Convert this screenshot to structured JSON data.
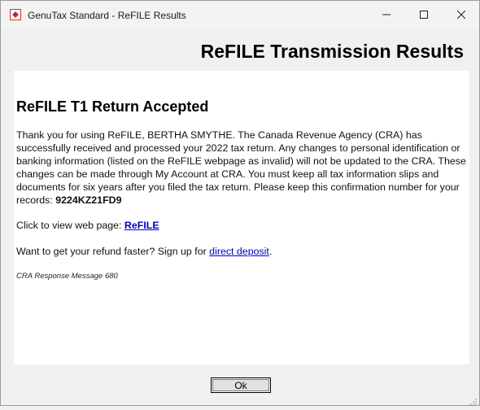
{
  "window": {
    "title": "GenuTax Standard - ReFILE Results"
  },
  "header": {
    "title": "ReFILE Transmission Results"
  },
  "content": {
    "heading": "ReFILE T1 Return Accepted",
    "paragraph_text": "Thank you for using ReFILE, BERTHA SMYTHE. The Canada Revenue Agency (CRA) has successfully received and processed your 2022 tax return. Any changes to personal identification or banking information (listed on the ReFILE webpage as invalid) will not be updated to the CRA. These changes can be made through My Account at CRA. You must keep all tax information slips and documents for six years after you filed the tax return. Please keep this confirmation number for your records: ",
    "confirmation_number": "9224KZ21FD9",
    "web_page_prefix": "Click to view web page: ",
    "web_page_link": "ReFILE",
    "refund_prefix": "Want to get your refund faster? Sign up for ",
    "refund_link": "direct deposit",
    "refund_suffix": ".",
    "cra_message": "CRA Response Message 680"
  },
  "footer": {
    "ok_label": "Ok"
  },
  "icons": {
    "app": "genutax-app-icon",
    "minimize": "minimize-icon",
    "maximize": "maximize-icon",
    "close": "close-icon",
    "resize": "resize-grip-icon"
  },
  "colors": {
    "link": "#0000cc",
    "content_bg": "#ffffff",
    "window_bg": "#f0f0f0"
  }
}
